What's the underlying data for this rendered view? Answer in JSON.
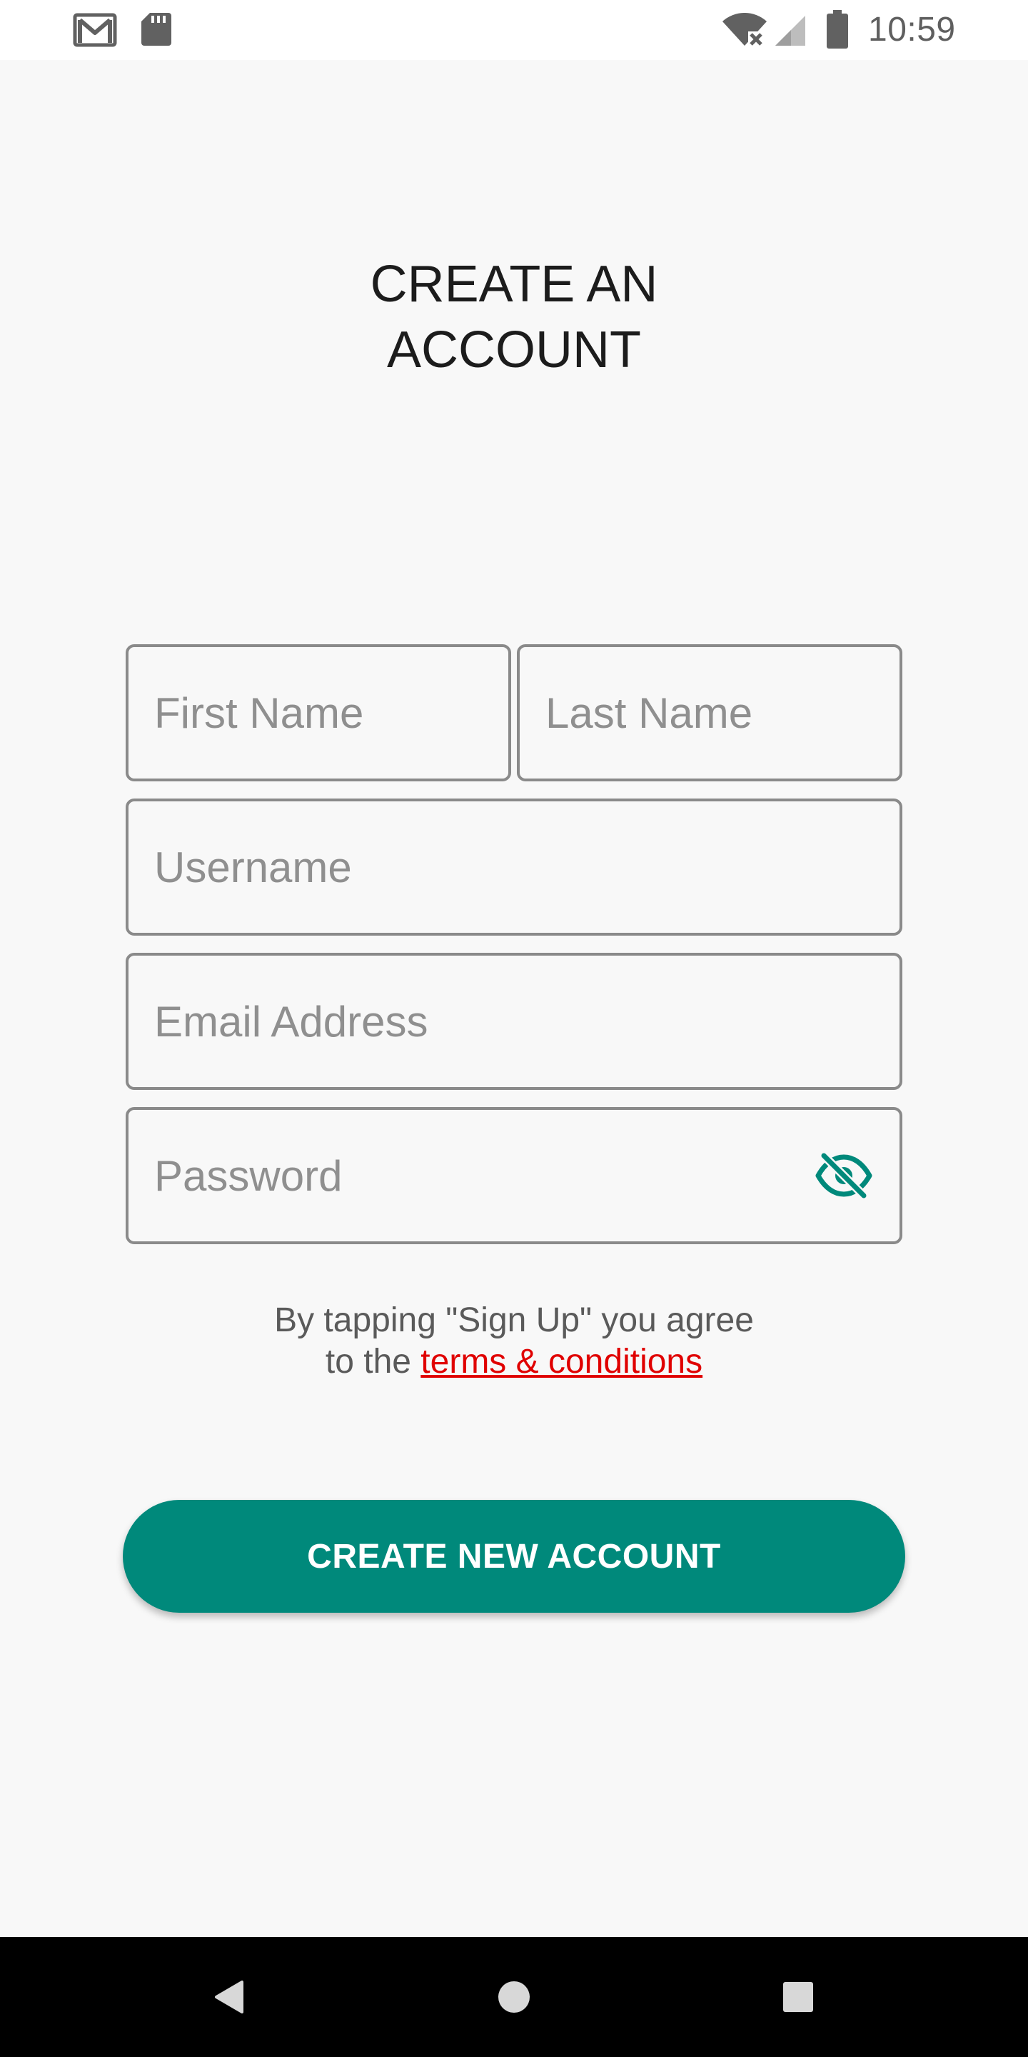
{
  "status_bar": {
    "time": "10:59",
    "icons": [
      "gmail-icon",
      "sd-card-icon",
      "wifi-off-icon",
      "cell-signal-icon",
      "battery-icon"
    ]
  },
  "title": {
    "line1": "CREATE AN",
    "line2": "ACCOUNT"
  },
  "form": {
    "first_name_placeholder": "First Name",
    "last_name_placeholder": "Last Name",
    "username_placeholder": "Username",
    "email_placeholder": "Email Address",
    "password_placeholder": "Password",
    "password_toggle_icon": "eye-off-icon"
  },
  "terms": {
    "line1": "By tapping \"Sign Up\" you agree",
    "line2_prefix": "to the ",
    "link": "terms & conditions"
  },
  "button": {
    "label": "CREATE NEW ACCOUNT"
  },
  "nav_bar": {
    "icons": [
      "back-icon",
      "home-icon",
      "recents-icon"
    ]
  },
  "colors": {
    "accent": "#00897b",
    "link": "#e00000",
    "background": "#f8f8f8"
  }
}
